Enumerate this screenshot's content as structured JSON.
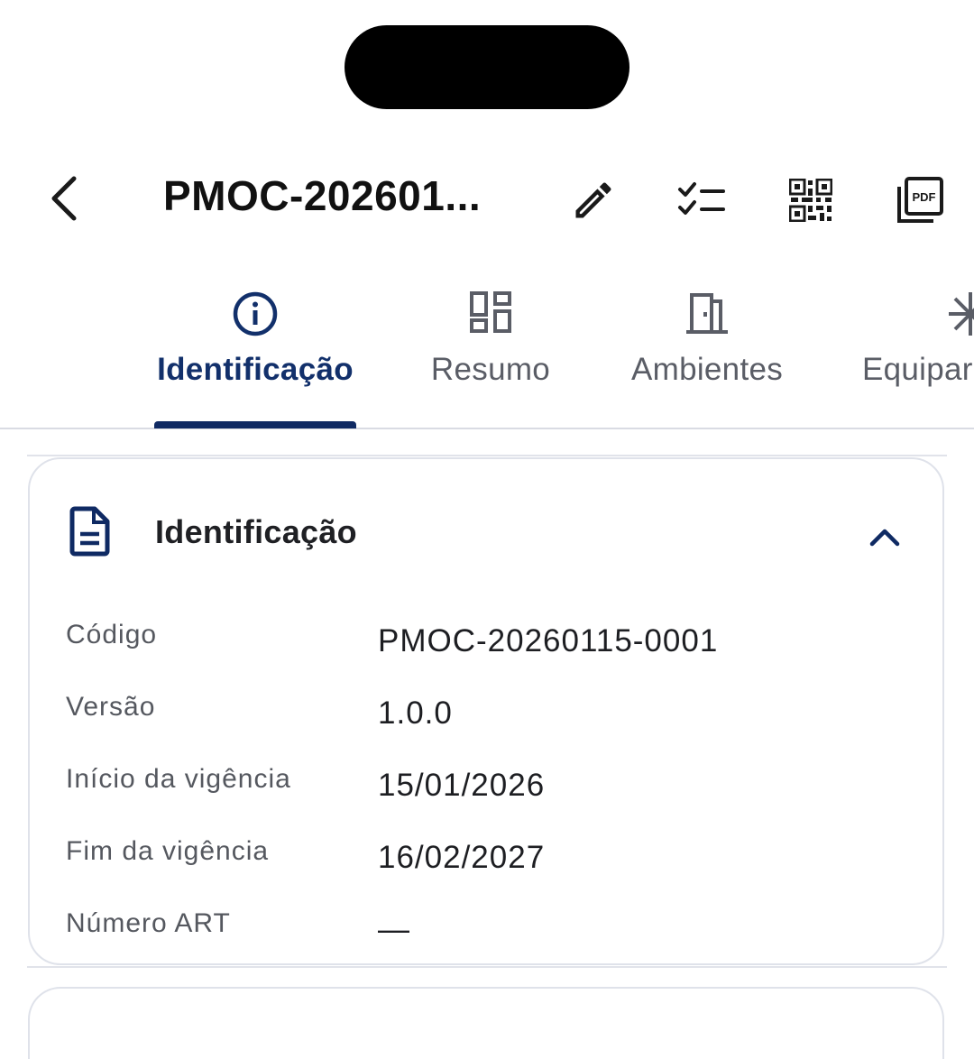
{
  "header": {
    "title": "PMOC-202601...",
    "actions": [
      {
        "name": "edit-icon"
      },
      {
        "name": "checklist-icon"
      },
      {
        "name": "qr-code-icon"
      },
      {
        "name": "pdf-icon",
        "text": "PDF"
      }
    ]
  },
  "tabs": [
    {
      "label": "Identificação",
      "icon": "info-icon",
      "active": true
    },
    {
      "label": "Resumo",
      "icon": "dashboard-icon",
      "active": false
    },
    {
      "label": "Ambientes",
      "icon": "door-icon",
      "active": false
    },
    {
      "label": "Equipar",
      "icon": "snowflake-icon",
      "active": false
    }
  ],
  "section": {
    "title": "Identificação",
    "icon": "document-icon",
    "rows": [
      {
        "label": "Código",
        "value": "PMOC-20260115-0001"
      },
      {
        "label": "Versão",
        "value": "1.0.0"
      },
      {
        "label": "Início da vigência",
        "value": "15/01/2026"
      },
      {
        "label": "Fim da vigência",
        "value": "16/02/2027"
      },
      {
        "label": "Número ART",
        "value": "—"
      }
    ]
  },
  "colors": {
    "accent": "#0f2a63",
    "active_tab_text": "#12306b",
    "inactive_tab_text": "#5a5d66",
    "border": "#dfe2ea"
  }
}
